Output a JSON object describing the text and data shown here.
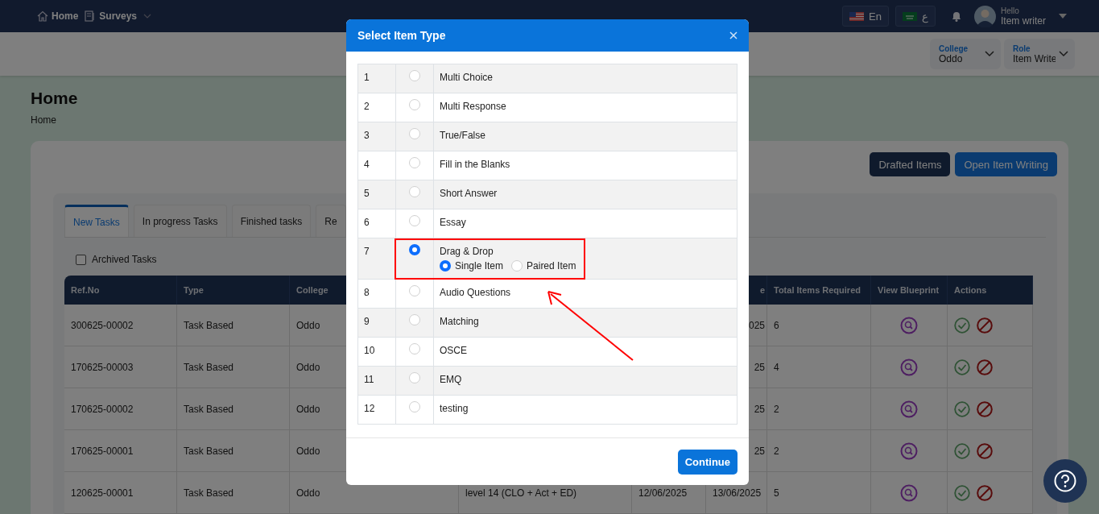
{
  "nav": {
    "items": [
      {
        "label": "Home",
        "kind": "home"
      },
      {
        "label": "Surveys",
        "kind": "menu"
      }
    ],
    "languages": [
      {
        "label": "En",
        "kind": "us"
      },
      {
        "label": "ع",
        "kind": "sa"
      }
    ],
    "greeting": "Hello",
    "user": "Item writer"
  },
  "filters": [
    {
      "label": "College",
      "value": "Oddo"
    },
    {
      "label": "Role",
      "value": "Item Write"
    }
  ],
  "page": {
    "title": "Home",
    "breadcrumb": "Home"
  },
  "actions": [
    {
      "label": "Drafted Items",
      "kind": "dark"
    },
    {
      "label": "Open Item Writing",
      "kind": "primary"
    }
  ],
  "tabs": [
    {
      "label": "New Tasks",
      "selected": true
    },
    {
      "label": "In progress Tasks",
      "selected": false
    },
    {
      "label": "Finished tasks",
      "selected": false
    },
    {
      "label": "Re",
      "selected": false
    }
  ],
  "archived": {
    "label": "Archived Tasks",
    "checked": false
  },
  "table": {
    "columns": [
      "Ref.No",
      "Type",
      "College",
      null,
      null,
      "e",
      "Total Items Required",
      "View Blueprint",
      "Actions"
    ],
    "rows": [
      {
        "cells": [
          "300625-00002",
          "Task Based",
          "Oddo",
          null,
          null,
          "025",
          "6"
        ]
      },
      {
        "cells": [
          "170625-00003",
          "Task Based",
          "Oddo",
          null,
          null,
          "25",
          "4"
        ]
      },
      {
        "cells": [
          "170625-00002",
          "Task Based",
          "Oddo",
          null,
          null,
          "25",
          "2"
        ]
      },
      {
        "cells": [
          "170625-00001",
          "Task Based",
          "Oddo",
          null,
          null,
          "25",
          "2"
        ]
      },
      {
        "cells": [
          "120625-00001",
          "Task Based",
          "Oddo",
          "level 14 (CLO + Act + ED)",
          "12/06/2025",
          "13/06/2025",
          "5"
        ]
      }
    ]
  },
  "modal": {
    "title": "Select Item Type",
    "items": [
      {
        "number": "1",
        "label": "Multi Choice",
        "selected": false
      },
      {
        "number": "2",
        "label": "Multi Response",
        "selected": false
      },
      {
        "number": "3",
        "label": "True/False",
        "selected": false
      },
      {
        "number": "4",
        "label": "Fill in the Blanks",
        "selected": false
      },
      {
        "number": "5",
        "label": "Short Answer",
        "selected": false
      },
      {
        "number": "6",
        "label": "Essay",
        "selected": false
      },
      {
        "number": "7",
        "label": "Drag & Drop",
        "selected": true,
        "options": [
          {
            "label": "Single Item",
            "selected": true
          },
          {
            "label": "Paired Item",
            "selected": false
          }
        ]
      },
      {
        "number": "8",
        "label": "Audio Questions",
        "selected": false
      },
      {
        "number": "9",
        "label": "Matching",
        "selected": false
      },
      {
        "number": "10",
        "label": "OSCE",
        "selected": false
      },
      {
        "number": "11",
        "label": "EMQ",
        "selected": false
      },
      {
        "number": "12",
        "label": "testing",
        "selected": false
      }
    ],
    "button": "Continue"
  }
}
